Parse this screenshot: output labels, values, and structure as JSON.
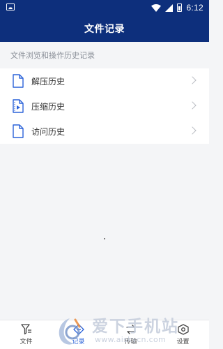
{
  "status_bar": {
    "time": "6:12"
  },
  "header": {
    "title": "文件记录"
  },
  "section_hint": "文件浏览和操作历史记录",
  "history_items": [
    {
      "label": "解压历史",
      "icon": "document-icon"
    },
    {
      "label": "压缩历史",
      "icon": "media-document-icon"
    },
    {
      "label": "访问历史",
      "icon": "document-icon"
    }
  ],
  "bottom_nav": {
    "tabs": [
      {
        "label": "文件",
        "icon": "file-filter-icon",
        "active": false
      },
      {
        "label": "记录",
        "icon": "record-icon",
        "active": true
      },
      {
        "label": "传输",
        "icon": "transfer-icon",
        "active": false
      },
      {
        "label": "设置",
        "icon": "settings-icon",
        "active": false
      }
    ]
  },
  "watermark": {
    "title": "爱下手机站",
    "url": "www.aiskycn.com"
  },
  "colors": {
    "header_bg": "#0d2f7c",
    "accent": "#2a62d9",
    "page_bg": "#f4f5f7"
  }
}
